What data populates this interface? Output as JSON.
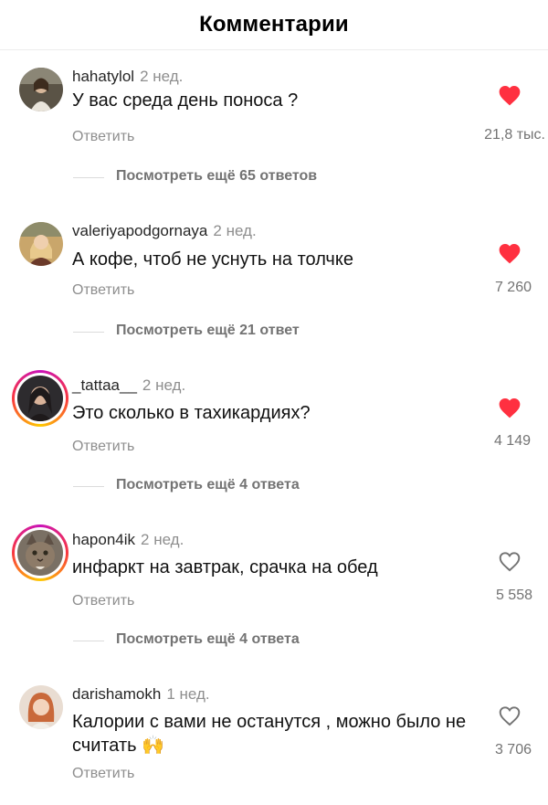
{
  "header": {
    "title": "Комментарии"
  },
  "comments": [
    {
      "username": "hahatylol",
      "time": "2 нед.",
      "text": "У вас среда день поноса ?",
      "reply": "Ответить",
      "likes": "21,8 тыс.",
      "liked": true,
      "avatar": "avatar-photo-woman"
    },
    {
      "username": "valeriyapodgornaya",
      "time": "2 нед.",
      "text": "А кофе, чтоб не уснуть  на толчке",
      "reply": "Ответить",
      "likes": "7 260",
      "liked": true,
      "avatar": "avatar-photo-woman-blonde"
    },
    {
      "username": "_tattaa__",
      "time": "2 нед.",
      "text": "Это сколько в тахикардиях?",
      "reply": "Ответить",
      "likes": "4 149",
      "liked": true,
      "avatar": "avatar-photo-woman-dark-hair",
      "story_ring": true
    },
    {
      "username": "hapon4ik",
      "time": "2 нед.",
      "text": "инфаркт на завтрак, срачка на обед",
      "reply": "Ответить",
      "likes": "5 558",
      "liked": false,
      "avatar": "avatar-photo-cat",
      "story_ring": true
    },
    {
      "username": "darishamokh",
      "time": "1 нед.",
      "text": "Калории с вами не останутся , можно было не считать 🙌",
      "reply": "Ответить",
      "likes": "3 706",
      "liked": false,
      "avatar": "avatar-photo-redhead"
    }
  ],
  "more_replies": [
    "Посмотреть ещё 65 ответов",
    "Посмотреть ещё 21 ответ",
    "Посмотреть ещё 4 ответа",
    "Посмотреть ещё 4 ответа"
  ],
  "colors": {
    "liked_heart": "#ff3040",
    "muted_text": "#8e8e8e",
    "divider": "#dbdbdb"
  },
  "icons": {
    "liked": "heart-filled-icon",
    "unliked": "heart-outline-icon"
  }
}
